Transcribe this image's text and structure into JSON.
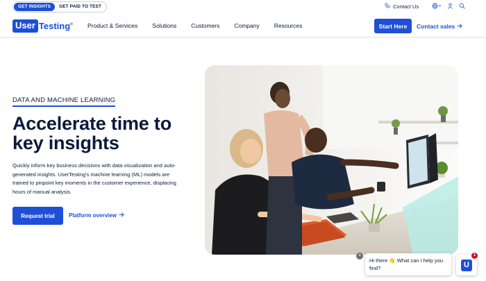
{
  "utility": {
    "toggle_active": "GET INSIGHTS",
    "toggle_inactive": "GET PAID TO TEST",
    "contact_us": "Contact Us"
  },
  "nav": {
    "logo_box": "User",
    "logo_text": "Testing",
    "logo_mark": "®",
    "items": [
      {
        "label": "Product & Services"
      },
      {
        "label": "Solutions"
      },
      {
        "label": "Customers"
      },
      {
        "label": "Company"
      },
      {
        "label": "Resources"
      }
    ],
    "start_button": "Start Here",
    "contact_sales": "Contact sales"
  },
  "hero": {
    "eyebrow": "DATA AND MACHINE LEARNING",
    "headline": "Accelerate time to key insights",
    "description": "Quickly inform key business decisions with data visualization and auto-generated insights. UserTesting's machine learning (ML) models are trained to pinpoint key moments in the customer experience, displacing hours of manual analysis.",
    "primary_button": "Request trial",
    "secondary_link": "Platform overview"
  },
  "chat": {
    "message": "Hi there 👋 What can I help you find?",
    "close": "×",
    "badge_count": "1",
    "launcher_letter": "U"
  },
  "colors": {
    "brand_blue": "#1f4fd6",
    "navy_text": "#0b1a3a",
    "badge_red": "#c8102e"
  }
}
